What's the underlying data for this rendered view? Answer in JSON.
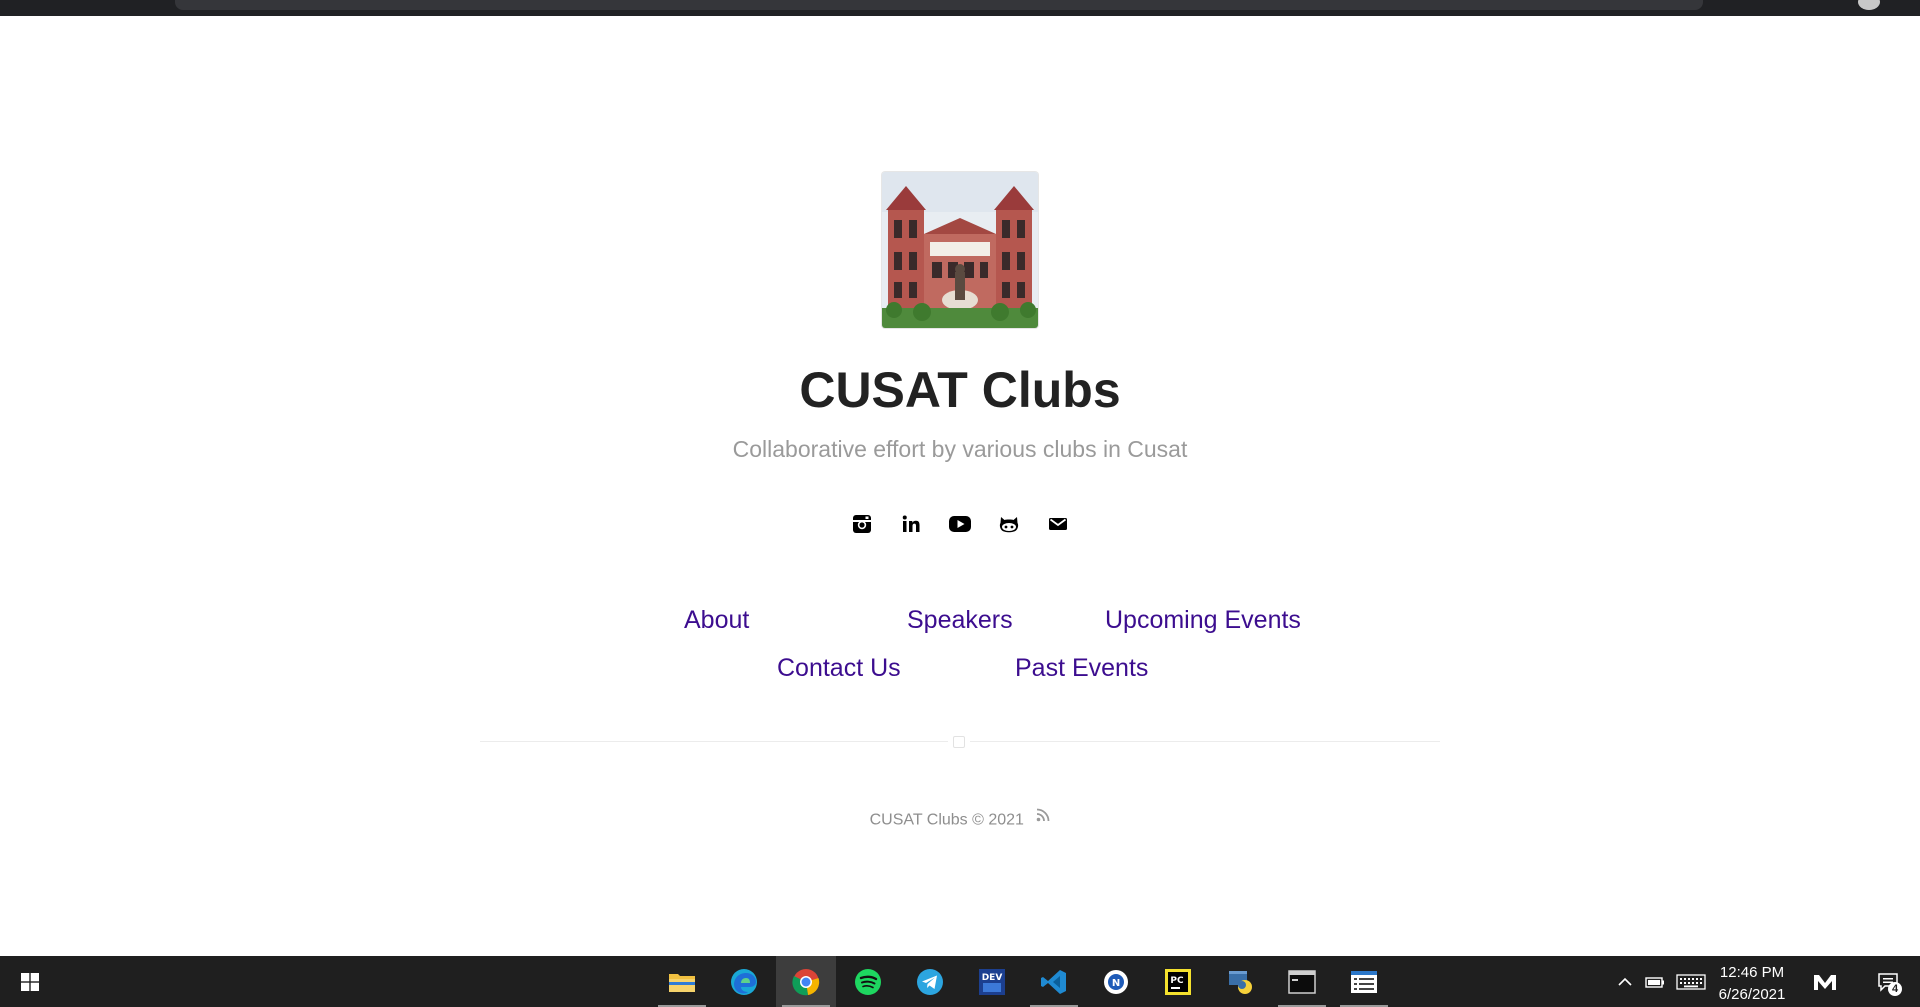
{
  "site": {
    "title": "CUSAT Clubs",
    "description": "Collaborative effort by various clubs in Cusat",
    "logo_alt": "CUSAT building logo"
  },
  "social": [
    {
      "name": "instagram-icon"
    },
    {
      "name": "linkedin-icon"
    },
    {
      "name": "youtube-icon"
    },
    {
      "name": "github-icon"
    },
    {
      "name": "email-icon"
    }
  ],
  "nav": {
    "about": "About",
    "speakers": "Speakers",
    "upcoming": "Upcoming Events",
    "contact": "Contact Us",
    "past": "Past Events"
  },
  "footer": {
    "text": "CUSAT Clubs © 2021"
  },
  "colors": {
    "link": "#3c0d8f",
    "title": "#222222",
    "muted": "#9a9a9a",
    "taskbar": "#1f1f1f"
  },
  "taskbar": {
    "apps": [
      {
        "name": "file-explorer-icon"
      },
      {
        "name": "edge-icon"
      },
      {
        "name": "chrome-icon"
      },
      {
        "name": "spotify-icon"
      },
      {
        "name": "telegram-icon"
      },
      {
        "name": "dev-cpp-icon"
      },
      {
        "name": "vscode-icon"
      },
      {
        "name": "app-icon"
      },
      {
        "name": "pycharm-icon"
      },
      {
        "name": "python-icon"
      },
      {
        "name": "terminal-icon"
      },
      {
        "name": "notepad-icon"
      }
    ],
    "time": "12:46 PM",
    "date": "6/26/2021",
    "notification_count": "4"
  }
}
